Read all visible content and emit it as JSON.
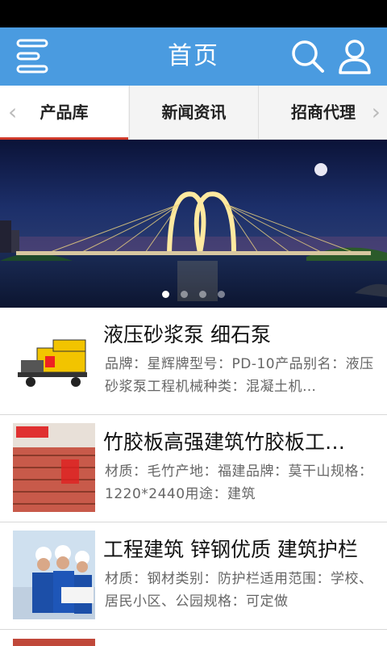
{
  "header": {
    "title": "首页"
  },
  "tabs": [
    {
      "label": "产品库"
    },
    {
      "label": "新闻资讯"
    },
    {
      "label": "招商代理"
    }
  ],
  "banner": {
    "slides": 4,
    "active_slide": 1
  },
  "products": [
    {
      "title": "液压砂浆泵 细石泵",
      "desc": "品牌：星辉牌型号：PD-10产品别名：液压砂浆泵工程机械种类：混凝土机…"
    },
    {
      "title": "竹胶板高强建筑竹胶板工…",
      "desc": "材质：毛竹产地：福建品牌：莫干山规格：1220*2440用途：建筑"
    },
    {
      "title": "工程建筑 锌钢优质 建筑护栏",
      "desc": "材质：钢材类别：防护栏适用范围：学校、居民小区、公园规格：可定做"
    }
  ],
  "colors": {
    "header_bg": "#4a9be0",
    "active_tab_underline": "#d03a2a"
  }
}
